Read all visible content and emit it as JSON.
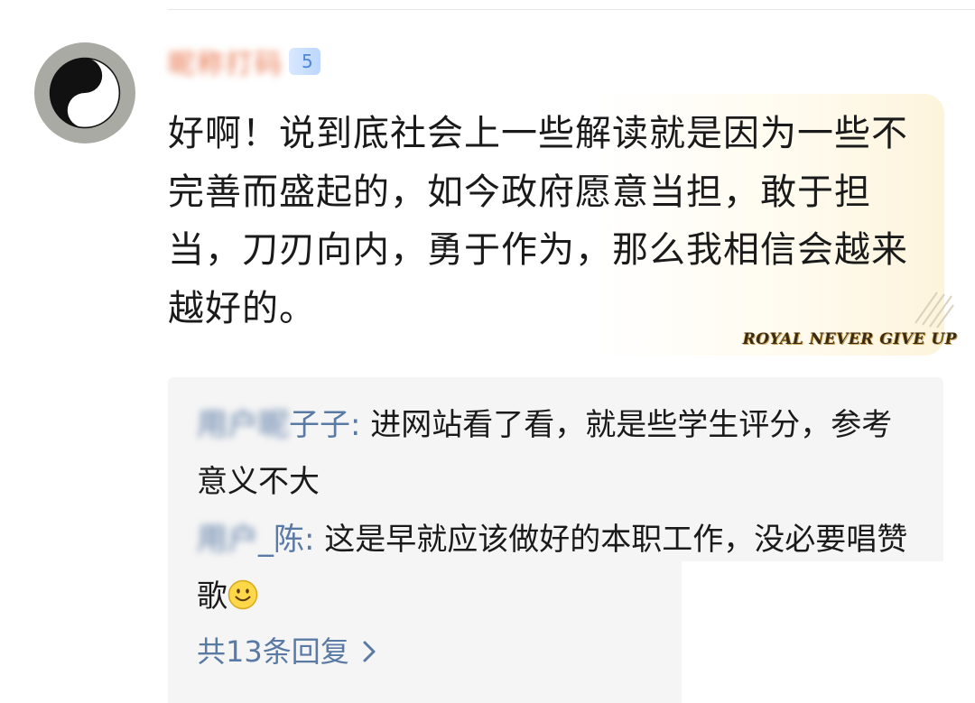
{
  "comment": {
    "author_name": "昵称打码",
    "level_badge": "5",
    "text": "好啊！说到底社会上一些解读就是因为一些不完善而盛起的，如今政府愿意当担，敢于担当，刀刃向内，勇于作为，那么我相信会越来越好的。",
    "watermark": "ROYAL NEVER GIVE UP"
  },
  "replies": [
    {
      "author_blurred": "用户昵",
      "author_visible": "子子",
      "separator": ": ",
      "text": "进网站看了看，就是些学生评分，参考意义不大"
    },
    {
      "author_blurred": "用户",
      "author_visible": "_陈",
      "separator": ": ",
      "text": "这是早就应该做好的本职工作，没必要唱赞歌",
      "emoji": "smile-emoji"
    }
  ],
  "reply_count_label": "共13条回复"
}
